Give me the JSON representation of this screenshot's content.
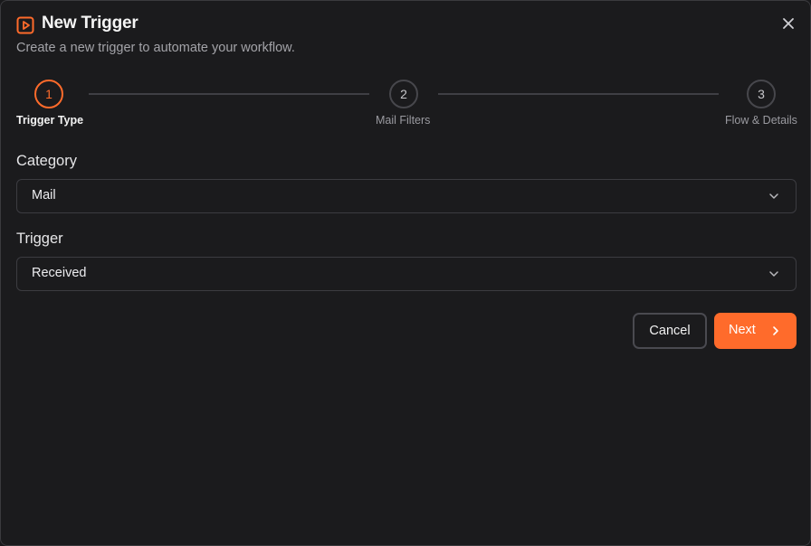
{
  "dialog": {
    "title": "New Trigger",
    "subtitle": "Create a new trigger to automate your workflow.",
    "icon": "play-square-icon",
    "close_icon": "close-icon",
    "accent_color": "#ff6b2b"
  },
  "stepper": {
    "active_step": 1,
    "steps": [
      {
        "number": "1",
        "label": "Trigger Type"
      },
      {
        "number": "2",
        "label": "Mail Filters"
      },
      {
        "number": "3",
        "label": "Flow & Details"
      }
    ]
  },
  "form": {
    "category": {
      "label": "Category",
      "value": "Mail"
    },
    "trigger": {
      "label": "Trigger",
      "value": "Received"
    }
  },
  "actions": {
    "cancel_label": "Cancel",
    "next_label": "Next"
  }
}
